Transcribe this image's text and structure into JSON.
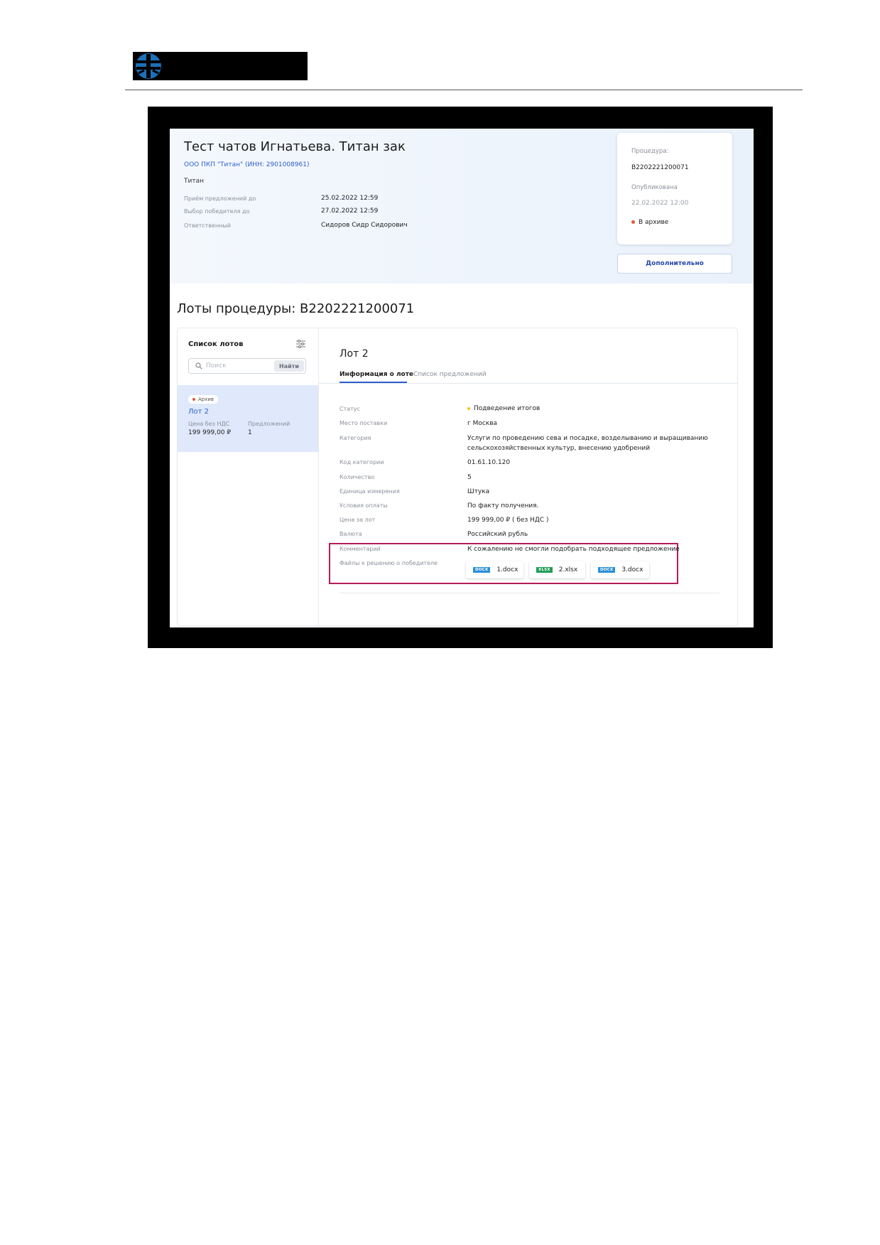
{
  "colors": {
    "accent": "#2d5ecb",
    "status_archive": "#e05a3a",
    "status_summary": "#f2c21a",
    "highlight": "#b51c5a",
    "docx": "#2a8fd6",
    "xlsx": "#1f9d55"
  },
  "procedure": {
    "title": "Тест чатов Игнатьева. Титан зак",
    "org_link": "ООО ПКП \"Титан\" (ИНН: 2901008961)",
    "org_short": "Титан",
    "meta": [
      {
        "label": "Приём предложений до",
        "value": "25.02.2022 12:59"
      },
      {
        "label": "Выбор победителя до",
        "value": "27.02.2022 12:59"
      },
      {
        "label": "Ответственный",
        "value": "Сидоров Сидр Сидорович"
      }
    ]
  },
  "info_card": {
    "procedure_label": "Процедура:",
    "procedure_number": "В2202221200071",
    "published_label": "Опубликована",
    "published_date": "22.02.2022 12:00",
    "status": "В архиве"
  },
  "more_button": "Дополнительно",
  "lots_title": "Лоты процедуры: В2202221200071",
  "sidebar": {
    "title": "Список лотов",
    "search_placeholder": "Поиск",
    "search_button": "Найти",
    "lot": {
      "badge": "Архив",
      "name": "Лот 2",
      "price_label": "Цена без НДС",
      "price_value": "199 999,00 ₽",
      "offers_label": "Предложений",
      "offers_value": "1"
    }
  },
  "detail": {
    "title": "Лот 2",
    "tabs": [
      "Информация о лоте",
      "Список предложений"
    ],
    "fields": {
      "status": {
        "label": "Статус",
        "value": "Подведение итогов"
      },
      "place": {
        "label": "Место поставки",
        "value": "г Москва"
      },
      "category": {
        "label": "Категория",
        "value_line1": "Услуги по проведению сева и посадке, возделыванию и выращиванию",
        "value_line2": "сельскохозяйственных культур, внесению удобрений"
      },
      "code": {
        "label": "Код категории",
        "value": "01.61.10.120"
      },
      "quantity": {
        "label": "Количество",
        "value": "5"
      },
      "unit": {
        "label": "Единица измерения",
        "value": "Штука"
      },
      "payment": {
        "label": "Условия оплаты",
        "value": "По факту получения."
      },
      "price": {
        "label": "Цена за лот",
        "value": "199 999,00 ₽  ( без НДС )"
      },
      "currency": {
        "label": "Валюта",
        "value": "Российский рубль"
      },
      "comment": {
        "label": "Комментарий",
        "value": "К сожалению не смогли подобрать подходящее предложение"
      },
      "files_label": "Файлы к решению о победителе"
    },
    "files": [
      {
        "type": "DOCX",
        "name": "1.docx"
      },
      {
        "type": "XLSX",
        "name": "2.xlsx"
      },
      {
        "type": "DOCX",
        "name": "3.docx"
      }
    ]
  }
}
